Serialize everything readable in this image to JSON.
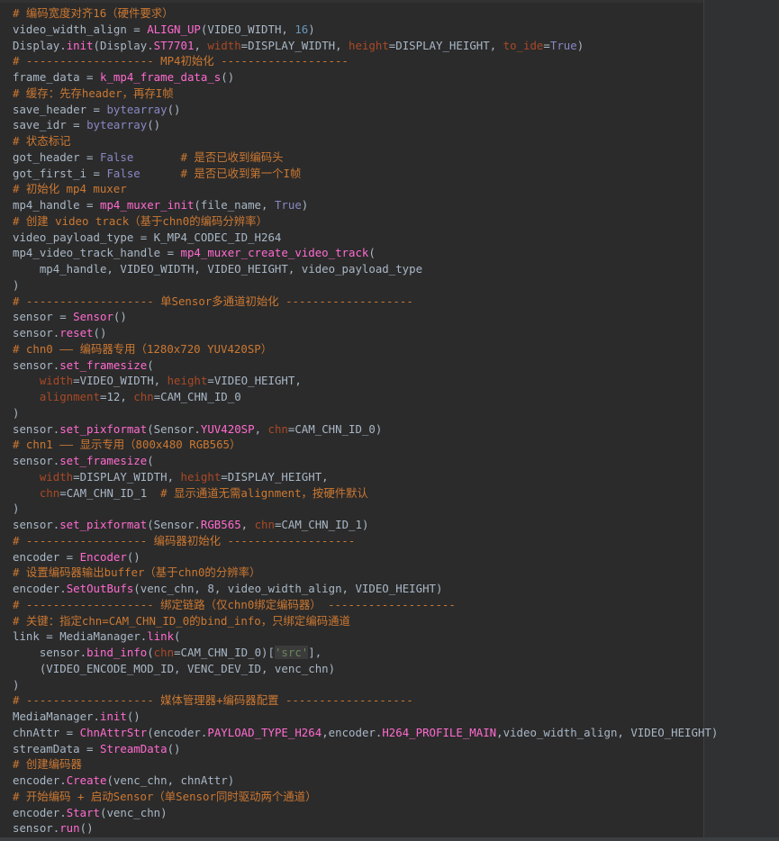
{
  "colors": {
    "background": "#2b2b2b",
    "comment": "#cc7832",
    "function": "#ff6bd0",
    "builtin": "#8888c6",
    "keyword_arg": "#aa4926",
    "number": "#6897bb",
    "string": "#6a8759",
    "text": "#a9b7c6"
  },
  "editor": {
    "lines": [
      [
        [
          "com",
          "# 编码宽度对齐16（硬件要求）"
        ]
      ],
      [
        [
          "txt",
          "video_width_align = "
        ],
        [
          "fn",
          "ALIGN_UP"
        ],
        [
          "txt",
          "(VIDEO_WIDTH, "
        ],
        [
          "num",
          "16"
        ],
        [
          "txt",
          ")"
        ]
      ],
      [
        [
          "txt",
          "Display."
        ],
        [
          "fn",
          "init"
        ],
        [
          "txt",
          "(Display."
        ],
        [
          "fn",
          "ST7701"
        ],
        [
          "txt",
          ", "
        ],
        [
          "kwa",
          "width"
        ],
        [
          "txt",
          "=DISPLAY_WIDTH, "
        ],
        [
          "kwa",
          "height"
        ],
        [
          "txt",
          "=DISPLAY_HEIGHT, "
        ],
        [
          "kwa",
          "to_ide"
        ],
        [
          "txt",
          "="
        ],
        [
          "kw",
          "True"
        ],
        [
          "txt",
          ")"
        ]
      ],
      [
        [
          "com",
          "# ------------------- MP4初始化 -------------------"
        ]
      ],
      [
        [
          "txt",
          "frame_data = "
        ],
        [
          "fn",
          "k_mp4_frame_data_s"
        ],
        [
          "txt",
          "()"
        ]
      ],
      [
        [
          "com",
          "# 缓存：先存header，再存I帧"
        ]
      ],
      [
        [
          "txt",
          "save_header = "
        ],
        [
          "kw",
          "bytearray"
        ],
        [
          "txt",
          "()"
        ]
      ],
      [
        [
          "txt",
          "save_idr = "
        ],
        [
          "kw",
          "bytearray"
        ],
        [
          "txt",
          "()"
        ]
      ],
      [
        [
          "com",
          "# 状态标记"
        ]
      ],
      [
        [
          "txt",
          "got_header = "
        ],
        [
          "kw",
          "False"
        ],
        [
          "txt",
          "       "
        ],
        [
          "com",
          "# 是否已收到编码头"
        ]
      ],
      [
        [
          "txt",
          "got_first_i = "
        ],
        [
          "kw",
          "False"
        ],
        [
          "txt",
          "      "
        ],
        [
          "com",
          "# 是否已收到第一个I帧"
        ]
      ],
      [
        [
          "com",
          "# 初始化 mp4 muxer"
        ]
      ],
      [
        [
          "txt",
          "mp4_handle = "
        ],
        [
          "fn",
          "mp4_muxer_init"
        ],
        [
          "txt",
          "(file_name, "
        ],
        [
          "kw",
          "True"
        ],
        [
          "txt",
          ")"
        ]
      ],
      [
        [
          "com",
          "# 创建 video track（基于chn0的编码分辨率）"
        ]
      ],
      [
        [
          "txt",
          "video_payload_type = K_MP4_CODEC_ID_H264"
        ]
      ],
      [
        [
          "txt",
          "mp4_video_track_handle = "
        ],
        [
          "fn",
          "mp4_muxer_create_video_track"
        ],
        [
          "txt",
          "("
        ]
      ],
      [
        [
          "txt",
          "    mp4_handle, VIDEO_WIDTH, VIDEO_HEIGHT, video_payload_type"
        ]
      ],
      [
        [
          "txt",
          ")"
        ]
      ],
      [
        [
          "com",
          "# ------------------- 单Sensor多通道初始化 -------------------"
        ]
      ],
      [
        [
          "txt",
          "sensor = "
        ],
        [
          "fn",
          "Sensor"
        ],
        [
          "txt",
          "()"
        ]
      ],
      [
        [
          "txt",
          "sensor."
        ],
        [
          "fn",
          "reset"
        ],
        [
          "txt",
          "()"
        ]
      ],
      [
        [
          "com",
          "# chn0 —— 编码器专用（1280x720 YUV420SP）"
        ]
      ],
      [
        [
          "txt",
          "sensor."
        ],
        [
          "fn",
          "set_framesize"
        ],
        [
          "txt",
          "("
        ]
      ],
      [
        [
          "txt",
          "    "
        ],
        [
          "kwa",
          "width"
        ],
        [
          "txt",
          "=VIDEO_WIDTH, "
        ],
        [
          "kwa",
          "height"
        ],
        [
          "txt",
          "=VIDEO_HEIGHT,"
        ]
      ],
      [
        [
          "txt",
          "    "
        ],
        [
          "kwa",
          "alignment"
        ],
        [
          "txt",
          "=12, "
        ],
        [
          "kwa",
          "chn"
        ],
        [
          "txt",
          "=CAM_CHN_ID_0"
        ]
      ],
      [
        [
          "txt",
          ")"
        ]
      ],
      [
        [
          "txt",
          "sensor."
        ],
        [
          "fn",
          "set_pixformat"
        ],
        [
          "txt",
          "(Sensor."
        ],
        [
          "fn",
          "YUV420SP"
        ],
        [
          "txt",
          ", "
        ],
        [
          "kwa",
          "chn"
        ],
        [
          "txt",
          "=CAM_CHN_ID_0)"
        ]
      ],
      [
        [
          "com",
          "# chn1 —— 显示专用（800x480 RGB565）"
        ]
      ],
      [
        [
          "txt",
          "sensor."
        ],
        [
          "fn",
          "set_framesize"
        ],
        [
          "txt",
          "("
        ]
      ],
      [
        [
          "txt",
          "    "
        ],
        [
          "kwa",
          "width"
        ],
        [
          "txt",
          "=DISPLAY_WIDTH, "
        ],
        [
          "kwa",
          "height"
        ],
        [
          "txt",
          "=DISPLAY_HEIGHT,"
        ]
      ],
      [
        [
          "txt",
          "    "
        ],
        [
          "kwa",
          "chn"
        ],
        [
          "txt",
          "=CAM_CHN_ID_1  "
        ],
        [
          "com",
          "# 显示通道无需alignment，按硬件默认"
        ]
      ],
      [
        [
          "txt",
          ")"
        ]
      ],
      [
        [
          "txt",
          "sensor."
        ],
        [
          "fn",
          "set_pixformat"
        ],
        [
          "txt",
          "(Sensor."
        ],
        [
          "fn",
          "RGB565"
        ],
        [
          "txt",
          ", "
        ],
        [
          "kwa",
          "chn"
        ],
        [
          "txt",
          "=CAM_CHN_ID_1)"
        ]
      ],
      [
        [
          "com",
          "# ------------------ 编码器初始化 -------------------"
        ]
      ],
      [
        [
          "txt",
          "encoder = "
        ],
        [
          "fn",
          "Encoder"
        ],
        [
          "txt",
          "()"
        ]
      ],
      [
        [
          "com",
          "# 设置编码器输出buffer（基于chn0的分辨率）"
        ]
      ],
      [
        [
          "txt",
          "encoder."
        ],
        [
          "fn",
          "SetOutBufs"
        ],
        [
          "txt",
          "(venc_chn, 8, video_width_align, VIDEO_HEIGHT)"
        ]
      ],
      [
        [
          "com",
          "# ------------------- 绑定链路（仅chn0绑定编码器） -------------------"
        ]
      ],
      [
        [
          "com",
          "# 关键：指定chn=CAM_CHN_ID_0的bind_info，只绑定编码通道"
        ]
      ],
      [
        [
          "txt",
          "link = MediaManager."
        ],
        [
          "fn",
          "link"
        ],
        [
          "txt",
          "("
        ]
      ],
      [
        [
          "txt",
          "    sensor."
        ],
        [
          "fn",
          "bind_info"
        ],
        [
          "txt",
          "("
        ],
        [
          "kwa",
          "chn"
        ],
        [
          "txt",
          "=CAM_CHN_ID_0)["
        ],
        [
          "strh",
          "'src'"
        ],
        [
          "txt",
          "],"
        ]
      ],
      [
        [
          "txt",
          "    (VIDEO_ENCODE_MOD_ID, VENC_DEV_ID, venc_chn)"
        ]
      ],
      [
        [
          "txt",
          ")"
        ]
      ],
      [
        [
          "com",
          "# ------------------- 媒体管理器+编码器配置 -------------------"
        ]
      ],
      [
        [
          "txt",
          "MediaManager."
        ],
        [
          "fn",
          "init"
        ],
        [
          "txt",
          "()"
        ]
      ],
      [
        [
          "txt",
          "chnAttr = "
        ],
        [
          "fn",
          "ChnAttrStr"
        ],
        [
          "txt",
          "(encoder."
        ],
        [
          "fn",
          "PAYLOAD_TYPE_H264"
        ],
        [
          "txt",
          ",encoder."
        ],
        [
          "fn",
          "H264_PROFILE_MAIN"
        ],
        [
          "txt",
          ",video_width_align, VIDEO_HEIGHT)"
        ]
      ],
      [
        [
          "txt",
          "streamData = "
        ],
        [
          "fn",
          "StreamData"
        ],
        [
          "txt",
          "()"
        ]
      ],
      [
        [
          "com",
          "# 创建编码器"
        ]
      ],
      [
        [
          "txt",
          "encoder."
        ],
        [
          "fn",
          "Create"
        ],
        [
          "txt",
          "(venc_chn, chnAttr)"
        ]
      ],
      [
        [
          "com",
          "# 开始编码 + 启动Sensor（单Sensor同时驱动两个通道）"
        ]
      ],
      [
        [
          "txt",
          "encoder."
        ],
        [
          "fn",
          "Start"
        ],
        [
          "txt",
          "(venc_chn)"
        ]
      ],
      [
        [
          "txt",
          "sensor."
        ],
        [
          "fn",
          "run"
        ],
        [
          "txt",
          "()"
        ]
      ]
    ]
  }
}
